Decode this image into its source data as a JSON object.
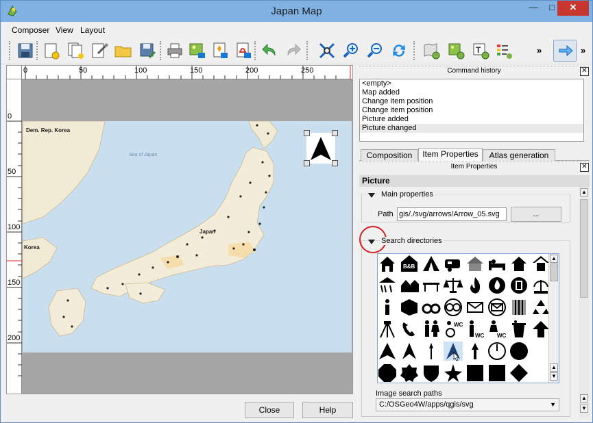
{
  "window": {
    "title": "Japan Map",
    "controls": {
      "minimize": "—",
      "maximize": "□",
      "close": "✕"
    }
  },
  "menu": [
    "Composer",
    "View",
    "Layout"
  ],
  "toolbar": {
    "icons": [
      "save-icon",
      "new-composer-icon",
      "duplicate-composer-icon",
      "composer-manager-icon",
      "open-template-icon",
      "save-template-icon",
      "print-icon",
      "export-image-icon",
      "export-svg-icon",
      "export-pdf-icon",
      "undo-icon",
      "redo-icon",
      "zoom-full-icon",
      "zoom-in-icon",
      "zoom-out-icon",
      "refresh-icon",
      "add-map-icon",
      "add-image-icon",
      "add-label-icon",
      "add-legend-icon",
      "select-move-icon"
    ],
    "overflow_glyph": "»"
  },
  "canvas": {
    "hruler_ticks": [
      "0",
      "50",
      "100",
      "150",
      "200",
      "250"
    ],
    "vruler_ticks": [
      "0",
      "50",
      "100",
      "150",
      "200"
    ],
    "map_labels": {
      "korea_dprk": "Dem. Rep. Korea",
      "korea": "Korea",
      "japan": "Japan",
      "sea": "Sea of Japan"
    }
  },
  "buttons": {
    "close": "Close",
    "help": "Help"
  },
  "command_history": {
    "title": "Command history",
    "close_glyph": "✕",
    "items": [
      "<empty>",
      "Map added",
      "Change item position",
      "Change item position",
      "Picture added",
      "Picture changed"
    ],
    "selected_index": 5
  },
  "tabs": [
    "Composition",
    "Item Properties",
    "Atlas generation"
  ],
  "active_tab": "Item Properties",
  "item_properties": {
    "dock_title": "Item Properties",
    "close_glyph": "✕",
    "section": "Picture",
    "main_properties": {
      "title": "Main properties",
      "path_label": "Path",
      "path_value": "gis/./svg/arrows/Arrow_05.svg",
      "browse_label": "..."
    },
    "search_directories": {
      "title": "Search directories",
      "symbols": [
        "shelter-icon",
        "bed-and-breakfast-icon",
        "tent-icon",
        "caravan-icon",
        "hut-icon",
        "hotel-bed-icon",
        "house-icon",
        "chalet-icon",
        "shelter-rain-icon",
        "house-small-icon",
        "bench-icon",
        "court-icon",
        "fire-icon",
        "fire-station-icon",
        "fire-hydrant-icon",
        "fountain-icon",
        "information-icon",
        "library-icon",
        "handcuffs-icon",
        "police-icon",
        "post-box-icon",
        "post-office-icon",
        "prison-icon",
        "recycling-icon",
        "survey-point-icon",
        "telephone-icon",
        "toilets-icon",
        "wheelchair-toilets-icon",
        "male-toilets-icon",
        "female-toilets-icon",
        "waste-basket-icon",
        "arrow-up-icon",
        "arrow-01-icon",
        "arrow-02-icon",
        "arrow-03-icon",
        "arrow-05-icon",
        "arrow-06-icon",
        "compass-icon",
        "circle-icon",
        "blank-icon",
        "octagon-icon",
        "badge-icon",
        "shield-icon",
        "star-icon",
        "square-icon",
        "square-2-icon",
        "diamond-icon",
        "blank-2-icon"
      ],
      "selected_symbol": "arrow-05-icon",
      "image_search_paths_label": "Image search paths",
      "image_search_paths_value": "C:/OSGeo4W/apps/qgis/svg"
    }
  },
  "colors": {
    "titlebar": "#7fb1e3",
    "close_button": "#c7372f",
    "selection": "#cfe3f7",
    "highlight_circle": "#d42020"
  }
}
